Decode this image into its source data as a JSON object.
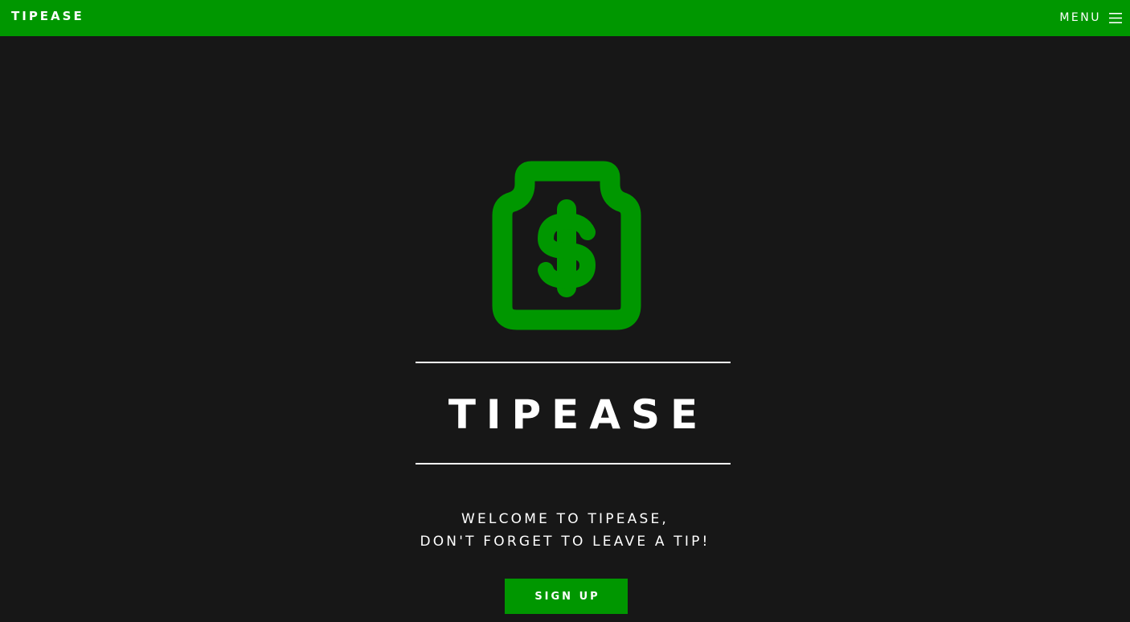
{
  "header": {
    "brand": "TIPEASE",
    "menu_label": "MENU",
    "menu_icon": "hamburger-icon",
    "background_color": "#009700"
  },
  "hero": {
    "icon": "tip-jar-dollar-icon",
    "icon_color": "#009700",
    "title": "TIPEASE",
    "tagline_line1": "WELCOME TO TIPEASE,",
    "tagline_line2": "DON'T FORGET TO LEAVE A TIP!",
    "signup_label": "SIGN UP"
  },
  "colors": {
    "page_background": "#171717",
    "accent": "#009700",
    "text": "#ffffff"
  }
}
